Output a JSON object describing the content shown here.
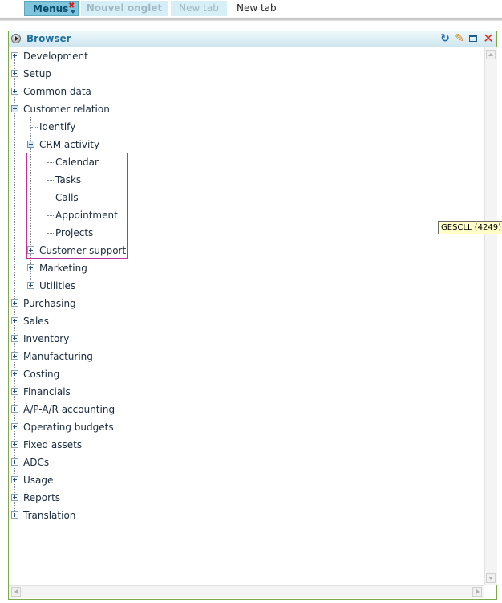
{
  "tabs": {
    "menus": "Menus",
    "nouvel_onglet": "Nouvel onglet",
    "new_tab_inactive": "New tab",
    "new_tab": "New tab"
  },
  "panel": {
    "title": "Browser"
  },
  "tree": {
    "development": "Development",
    "setup": "Setup",
    "common_data": "Common data",
    "customer_relation": "Customer relation",
    "identify": "Identify",
    "crm_activity": "CRM activity",
    "calendar": "Calendar",
    "tasks": "Tasks",
    "calls": "Calls",
    "appointment": "Appointment",
    "projects": "Projects",
    "customer_support": "Customer support",
    "marketing": "Marketing",
    "utilities": "Utilities",
    "purchasing": "Purchasing",
    "sales": "Sales",
    "inventory": "Inventory",
    "manufacturing": "Manufacturing",
    "costing": "Costing",
    "financials": "Financials",
    "ap_ar_accounting": "A/P-A/R accounting",
    "operating_budgets": "Operating budgets",
    "fixed_assets": "Fixed assets",
    "adcs": "ADCs",
    "usage": "Usage",
    "reports": "Reports",
    "translation": "Translation"
  },
  "tooltip": "GESCLL (4249)",
  "colors": {
    "active_tab": "#7fc6dc",
    "header_title": "#1e6f9c",
    "panel_border": "#7aaa4a",
    "highlight_box": "#c0309a"
  }
}
